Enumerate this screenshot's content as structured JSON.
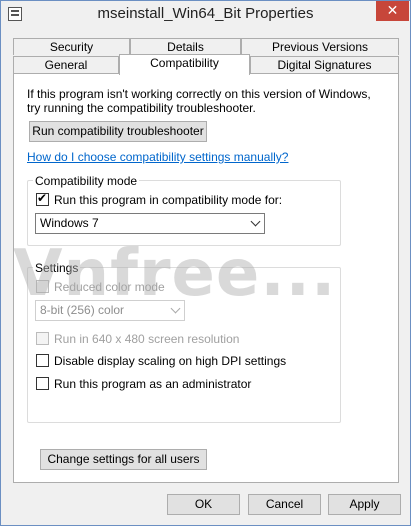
{
  "window": {
    "title": "mseinstall_Win64_Bit Properties",
    "close_glyph": "✕"
  },
  "tabs": {
    "row1": [
      "Security",
      "Details",
      "Previous Versions"
    ],
    "row2": [
      "General",
      "Compatibility",
      "Digital Signatures"
    ],
    "active": "Compatibility"
  },
  "compat": {
    "intro": "If this program isn't working correctly on this version of Windows, try running the compatibility troubleshooter.",
    "troubleshooter_button": "Run compatibility troubleshooter",
    "help_link": "How do I choose compatibility settings manually?",
    "mode_group_label": "Compatibility mode",
    "mode_checkbox_label": "Run this program in compatibility mode for:",
    "mode_checked": true,
    "mode_select_value": "Windows 7",
    "settings_group_label": "Settings",
    "reduced_color_label": "Reduced color mode",
    "color_select_value": "8-bit (256) color",
    "res_640_label": "Run in 640 x 480 screen resolution",
    "dpi_label": "Disable display scaling on high DPI settings",
    "admin_label": "Run this program as an administrator",
    "all_users_button": "Change settings for all users"
  },
  "footer": {
    "ok": "OK",
    "cancel": "Cancel",
    "apply": "Apply"
  },
  "watermark": "Vnfree..."
}
